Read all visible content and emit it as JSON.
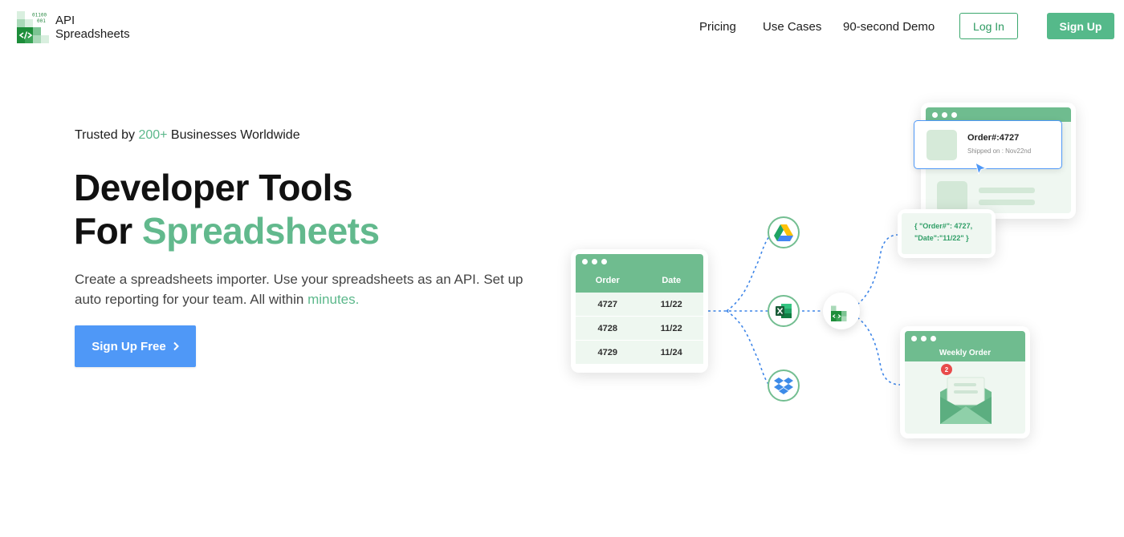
{
  "brand": {
    "name_line1": "API",
    "name_line2": "Spreadsheets",
    "logo_bits_line1": "01100",
    "logo_bits_line2": "001",
    "logo_icon": "code-brackets-icon",
    "colors": {
      "accent": "#5cb88b",
      "primary_blue": "#4f98f7",
      "signup_green": "#55b98a"
    }
  },
  "nav": {
    "links": [
      {
        "label": "Pricing"
      },
      {
        "label": "Use Cases"
      },
      {
        "label": "90-second Demo"
      }
    ],
    "login_label": "Log In",
    "signup_label": "Sign Up"
  },
  "hero": {
    "trusted_prefix": "Trusted by ",
    "trusted_count": "200+",
    "trusted_suffix": " Businesses Worldwide",
    "headline_line1": "Developer Tools",
    "headline_line2_prefix": "For ",
    "headline_line2_accent": "Spreadsheets",
    "subtext": "Create a spreadsheets importer. Use your spreadsheets as an API. Set up auto reporting for your team. All within ",
    "subtext_accent": "minutes.",
    "cta_label": "Sign Up Free",
    "cta_icon": "chevron-right-icon"
  },
  "illustration": {
    "table": {
      "headers": [
        "Order",
        "Date"
      ],
      "rows": [
        [
          "4727",
          "11/22"
        ],
        [
          "4728",
          "11/22"
        ],
        [
          "4729",
          "11/24"
        ]
      ]
    },
    "integrations": [
      "google-drive-icon",
      "excel-icon",
      "dropbox-icon"
    ],
    "order_popup": {
      "title": "Order#:4727",
      "subtitle": "Shipped on : Nov22nd"
    },
    "json_snippet": {
      "line1": "{ \"Order#\": 4727,",
      "line2": "\"Date\":\"11/22\" }"
    },
    "weekly": {
      "title": "Weekly Order",
      "badge": "2"
    }
  }
}
